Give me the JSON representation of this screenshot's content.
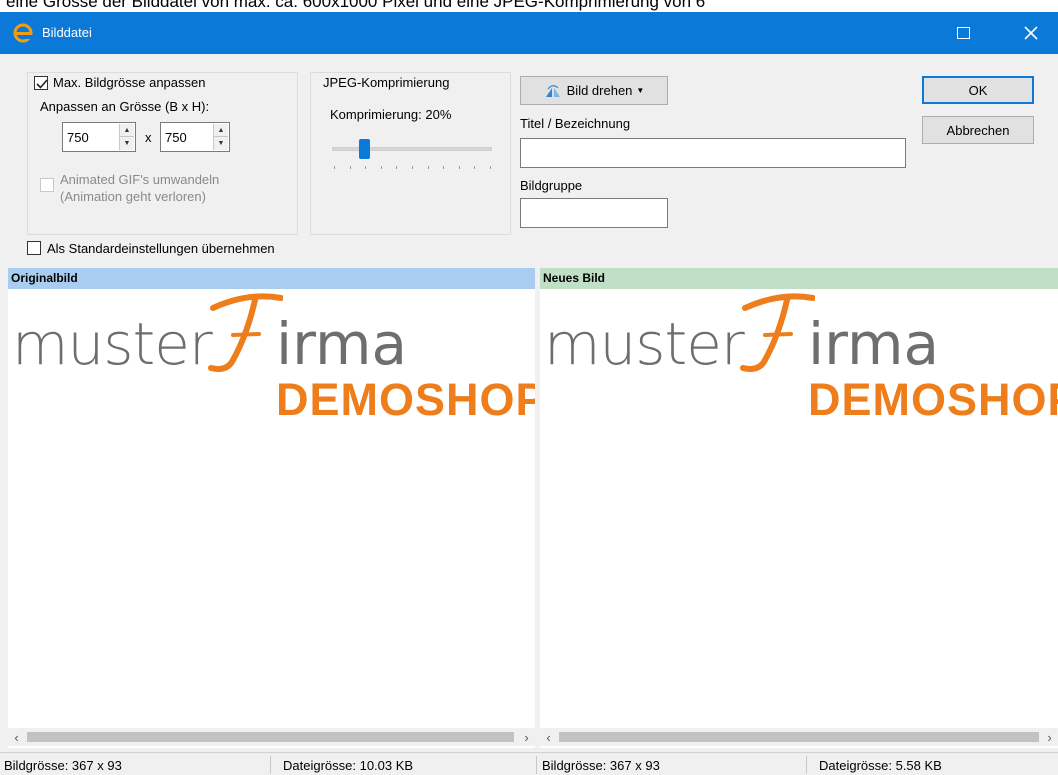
{
  "caption_text": "eine Grösse der Bilddatei von max. ca. 600x1000 Pixel und eine JPEG-Komprimierung von 6",
  "window": {
    "title": "Bilddatei"
  },
  "resize_group": {
    "checkbox_label": "Max. Bildgrösse anpassen",
    "checked": true,
    "size_label": "Anpassen an Grösse (B x H):",
    "width_value": "750",
    "height_value": "750",
    "times_label": "x",
    "gif_label_line1": "Animated GIF's umwandeln",
    "gif_label_line2": "(Animation geht verloren)"
  },
  "jpeg_group": {
    "title": "JPEG-Komprimierung",
    "compression_label": "Komprimierung: 20%",
    "compression_percent": 20
  },
  "rotate_button_label": "Bild drehen",
  "title_field": {
    "label": "Titel / Bezeichnung",
    "value": ""
  },
  "group_field": {
    "label": "Bildgruppe",
    "value": ""
  },
  "ok_label": "OK",
  "cancel_label": "Abbrechen",
  "defaults_checkbox_label": "Als Standardeinstellungen übernehmen",
  "original_pane": {
    "header": "Originalbild",
    "header_color": "#a8cdf0",
    "image_size": "Bildgrösse:  367 x 93",
    "file_size": "Dateigrösse: 10.03 KB"
  },
  "new_pane": {
    "header": "Neues Bild",
    "header_color": "#bfe0c4",
    "image_size": "Bildgrösse:  367 x 93",
    "file_size": "Dateigrösse: 5.58 KB"
  },
  "logo": {
    "word1": "muster",
    "word2": "irma",
    "word3": "DEMOSHOP",
    "gray": "#6e6e6e",
    "orange": "#ee7d1c"
  },
  "colors": {
    "accent": "#0b79d7"
  }
}
